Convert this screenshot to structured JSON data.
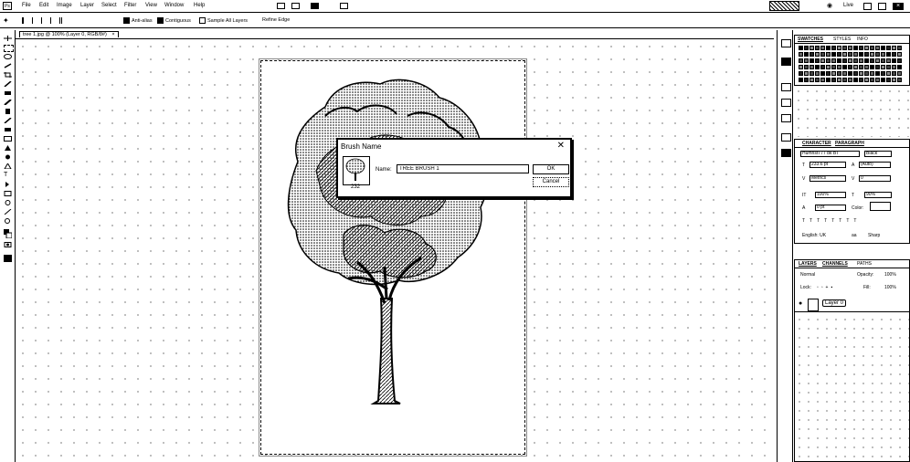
{
  "menubar": {
    "app_icon": "ps-logo-icon",
    "items": [
      "File",
      "Edit",
      "Image",
      "Layer",
      "Select",
      "Filter",
      "View",
      "Window",
      "Help"
    ],
    "live_label": "Live",
    "icons": [
      "bridge-icon",
      "minibridge-icon",
      "arrange-icon",
      "search-icon",
      "window-controls-icon"
    ]
  },
  "options": {
    "anti_alias": "Anti-alias",
    "contiguous": "Contiguous",
    "sample_all_layers": "Sample All Layers",
    "refine_edge": "Refine Edge"
  },
  "tab": {
    "title": "tree 1.jpg @ 100% (Layer 0, RGB/8#)",
    "close": "×"
  },
  "dialog": {
    "title": "Brush Name",
    "close": "✕",
    "name_label": "Name:",
    "name_value": "TREE BRUSH 1",
    "ok": "OK",
    "cancel": "Cancel",
    "brush_size": "232"
  },
  "panels": {
    "swatches_tabs": [
      "SWATCHES",
      "STYLES",
      "INFO"
    ],
    "character_tabs": [
      "CHARACTER",
      "PARAGRAPH"
    ],
    "character": {
      "font": "HumnstT77 bk BT",
      "style": "Black",
      "size": "233.6 pt",
      "leading": "(Auto)",
      "tracking": "Metrics",
      "kerning": "0",
      "v_scale": "100%",
      "h_scale": "90%",
      "baseline": "0 pt",
      "color_label": "Color:",
      "language": "English: UK",
      "aa": "Sharp"
    },
    "layers_tabs": [
      "LAYERS",
      "CHANNELS",
      "PATHS"
    ],
    "layers": {
      "blend": "Normal",
      "opacity_label": "Opacity:",
      "opacity": "100%",
      "lock_label": "Lock:",
      "fill_label": "Fill:",
      "fill": "100%",
      "layer_name": "Layer 0"
    }
  }
}
